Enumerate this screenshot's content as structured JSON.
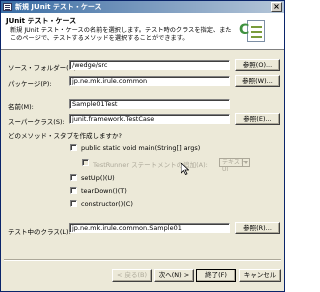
{
  "window": {
    "title": "新規 JUnit テスト・ケース",
    "close_label": "×"
  },
  "header": {
    "title": "JUnit テスト・ケース",
    "description": "新規 JUnit テスト・ケースの名前を選択します。テスト時のクラスを指定、またこのページで、テストするメソッドを選択することができます。"
  },
  "form": {
    "source_folder": {
      "label": "ソース・フォルダー(D):",
      "value": "/wedge/src",
      "button": "参照(O)..."
    },
    "package": {
      "label": "パッケージ(P):",
      "value": "jp.ne.mk.irule.common",
      "button": "参照(W)..."
    },
    "name": {
      "label": "名前(M):",
      "value": "Sample01Test"
    },
    "superclass": {
      "label": "スーパークラス(S):",
      "value": "junit.framework.TestCase",
      "button": "参照(E)..."
    },
    "stubs_prompt": "どのメソッド・スタブを作成しますか?",
    "stubs": {
      "main": "public static void main(String[] args)",
      "runner": "TestRunner ステートメントの追加(A):",
      "runner_combo": "テキスト UI",
      "setup": "setUp()(U)",
      "teardown": "tearDown()(T)",
      "constructor": "constructor()(C)"
    },
    "class_under_test": {
      "label": "テスト中のクラス(L):",
      "value": "jp.ne.mk.irule.common.Sample01",
      "button": "参照(R)..."
    }
  },
  "footer": {
    "back": "< 戻る(B)",
    "next": "次へ(N) >",
    "finish": "終了(F)",
    "cancel": "キャンセル"
  }
}
